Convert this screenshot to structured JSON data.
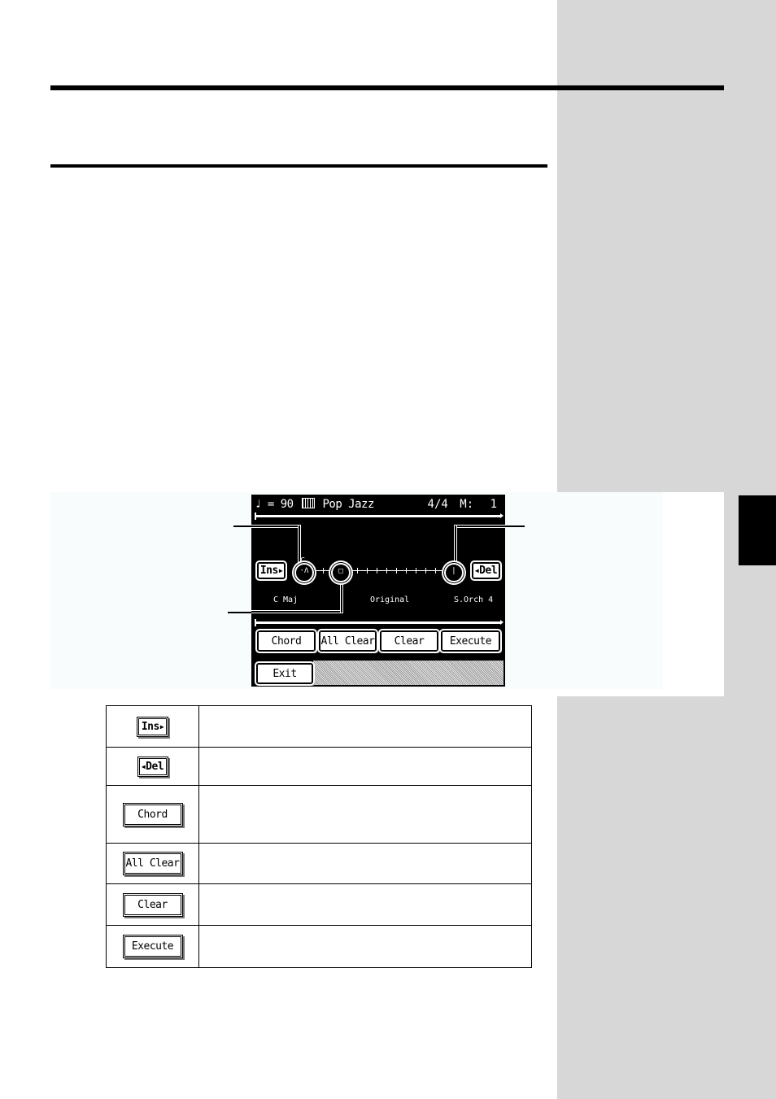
{
  "page": {
    "colors": {
      "sidebar": "#d7d7d7",
      "figure_panel": "#f8fcfd",
      "lcd_background": "#000000",
      "lcd_foreground": "#ffffff"
    }
  },
  "lcd": {
    "header": {
      "tempo_icon": "quarter-note-icon",
      "tempo": "= 90",
      "style_icon": "rhythm-book-icon",
      "style_name": "Pop Jazz",
      "time_signature": "4/4",
      "measure_label": "M:",
      "measure_value": "1"
    },
    "ins_button": "Ins",
    "del_button": "Del",
    "chord_marker_label": "C",
    "labels": {
      "chord": "C Maj",
      "center": "Original",
      "right": "S.Orch 4"
    },
    "buttons": [
      "Chord",
      "All Clear",
      "Clear",
      "Execute"
    ],
    "exit_button": "Exit"
  },
  "table": {
    "rows": [
      {
        "button": "Ins",
        "icon": "play-right-icon",
        "description": ""
      },
      {
        "button": "Del",
        "icon": "play-left-icon",
        "description": ""
      },
      {
        "button": "Chord",
        "description": ""
      },
      {
        "button": "All Clear",
        "description": ""
      },
      {
        "button": "Clear",
        "description": ""
      },
      {
        "button": "Execute",
        "description": ""
      }
    ]
  }
}
